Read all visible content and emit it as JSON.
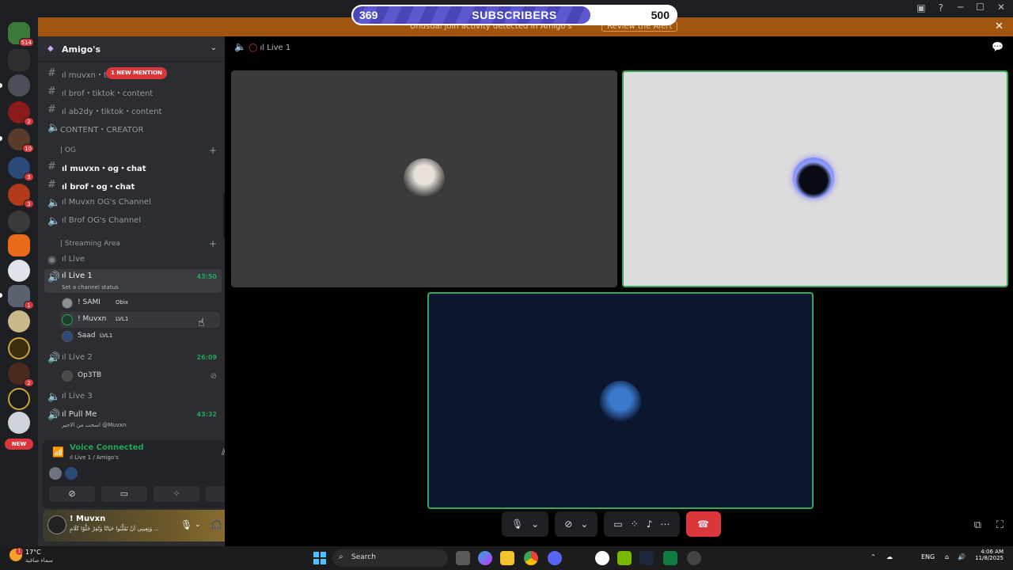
{
  "subscriber_bar": {
    "current": "369",
    "label": "SUBSCRIBERS",
    "goal": "500",
    "progress_fraction": 0.735
  },
  "alert": {
    "text": "Unusual join activity detected in Amigo's",
    "button": "Review the Alert"
  },
  "rail": {
    "badges": [
      "514",
      "2",
      "10",
      "3",
      "3",
      "1",
      "2"
    ],
    "new_label": "NEW"
  },
  "guild": {
    "name": "Amigo's"
  },
  "channels": {
    "mention_badge": "1 NEW MENTION",
    "text1": "ıl muvxn・tiktok・content",
    "text2": "ıl brof・tiktok・content",
    "text3": "ıl ab2dy・tiktok・content",
    "voice_creator": "CONTENT・CREATOR",
    "cat_og": "| OG",
    "og1": "ıl muvxn・og・chat",
    "og2": "ıl brof・og・chat",
    "og3": "ıl Muvxn OG's Channel",
    "og4": "ıl Brof OG's Channel",
    "cat_stream": "| Streaming Area",
    "live": "ıl Live",
    "live1": "ıl Live 1",
    "live1_time": "43:50",
    "live1_status": "Set a channel status",
    "live2": "ıl Live 2",
    "live2_time": "26:09",
    "live3": "ıl Live 3",
    "pullme": "ıl Pull Me",
    "pullme_time": "43:32",
    "pullme_status": "اسحب من الاخير @Muvxn"
  },
  "voice_users": [
    {
      "name": "! SAMI",
      "tag": "Obix"
    },
    {
      "name": "! Muvxn",
      "tag": "LVL1"
    },
    {
      "name": "Saad",
      "tag": "LVL1"
    },
    {
      "name": "Op3TB",
      "tag": ""
    }
  ],
  "voice_panel": {
    "title": "Voice Connected",
    "sub": "ıl Live 1 / Amigo's"
  },
  "user_panel": {
    "name": "! Muvxn",
    "status": "وَنِعِينِي اَنْ تَقَلِّبُوا حَيَاتًا وَتْفِرْ خَلَّوْا كَلَامِ ..."
  },
  "main": {
    "channel": "ıl Live 1"
  },
  "taskbar": {
    "temp": "17°C",
    "condition": "سماء صافية",
    "search": "Search",
    "lang": "ENG",
    "time": "4:06 AM",
    "date": "11/8/2025",
    "weather_badge": "1"
  },
  "colors": {
    "accent_green": "#23a55a",
    "alert_orange": "#a1560f",
    "danger_red": "#da373c",
    "blurple": "#5865f2"
  }
}
